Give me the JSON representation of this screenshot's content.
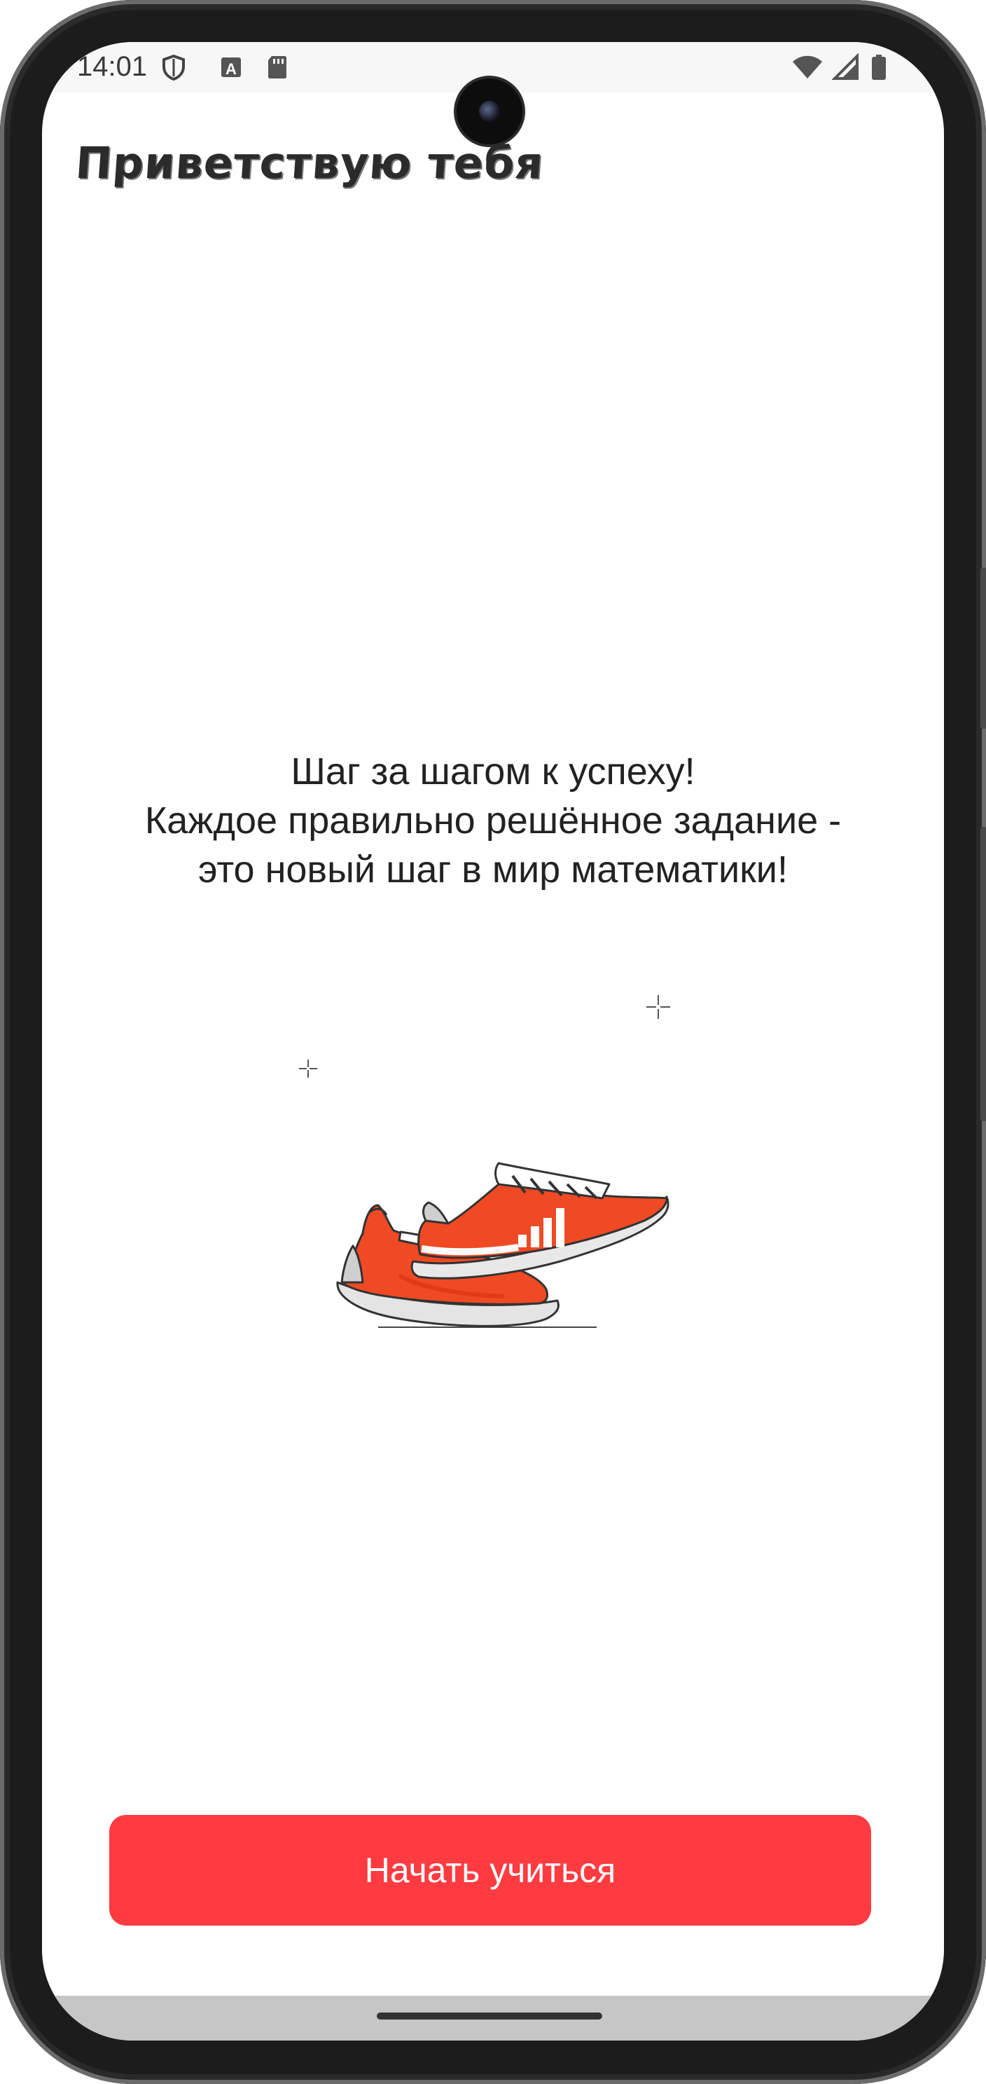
{
  "status_bar": {
    "time": "14:01",
    "left_icons": [
      "shield-icon",
      "a-box-icon",
      "sd-card-icon"
    ],
    "right_icons": [
      "wifi-icon",
      "signal-icon",
      "battery-icon"
    ]
  },
  "header": {
    "greeting": "Приветствую тебя"
  },
  "main": {
    "motivation_lines": [
      "Шаг за шагом к успеху!",
      "Каждое правильно решённое задание -",
      "это новый шаг в мир математики!"
    ],
    "illustration": "sneakers-illustration"
  },
  "actions": {
    "start_label": "Начать учиться"
  },
  "colors": {
    "accent": "#ff3b42",
    "sneaker": "#f04a24",
    "text": "#222222"
  }
}
